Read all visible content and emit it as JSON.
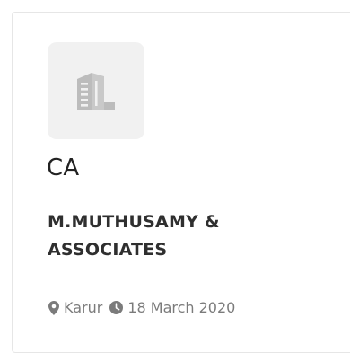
{
  "listing": {
    "title": "CA",
    "company": "M.MUTHUSAMY & ASSOCIATES",
    "location": "Karur",
    "date": "18 March 2020",
    "icons": {
      "logo": "building-icon",
      "location": "map-marker-icon",
      "date": "clock-icon"
    }
  }
}
